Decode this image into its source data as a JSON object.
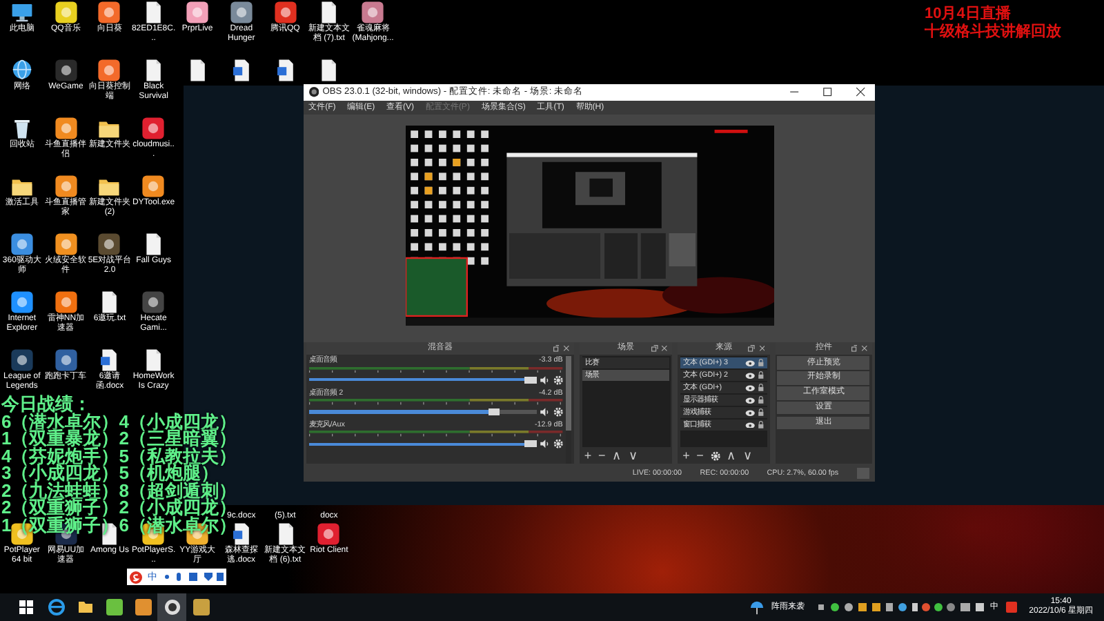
{
  "desktop": {
    "icon_rows": [
      [
        {
          "kind": "computer",
          "label": "此电脑"
        },
        {
          "kind": "app",
          "color": "#e8d020",
          "label": "QQ音乐"
        },
        {
          "kind": "app",
          "color": "#f36a2a",
          "label": "向日葵"
        },
        {
          "kind": "file",
          "label": "82ED1E8C..."
        },
        {
          "kind": "app",
          "color": "#f2a0b8",
          "label": "PrprLive"
        },
        {
          "kind": "app",
          "color": "#7a8a9a",
          "label": "Dread Hunger"
        },
        {
          "kind": "app",
          "color": "#e03020",
          "label": "腾讯QQ"
        },
        {
          "kind": "file",
          "label": "新建文本文档 (7).txt"
        },
        {
          "kind": "app",
          "color": "#c87a90",
          "label": "雀魂麻将 (Mahjong..."
        }
      ],
      [
        {
          "kind": "network",
          "label": "网络"
        },
        {
          "kind": "app",
          "color": "#2a2a2a",
          "label": "WeGame"
        },
        {
          "kind": "app",
          "color": "#f36a2a",
          "label": "向日葵控制端"
        },
        {
          "kind": "file",
          "label": "Black Survival"
        },
        {
          "kind": "file"
        },
        {
          "kind": "doc"
        },
        {
          "kind": "doc"
        },
        {
          "kind": "file"
        }
      ],
      [
        {
          "kind": "recycle",
          "label": "回收站"
        },
        {
          "kind": "app",
          "color": "#f08a20",
          "label": "斗鱼直播伴侣"
        },
        {
          "kind": "folder",
          "label": "新建文件夹"
        },
        {
          "kind": "app",
          "color": "#e02030",
          "label": "cloudmusi..."
        }
      ],
      [
        {
          "kind": "folder",
          "label": "激活工具"
        },
        {
          "kind": "app",
          "color": "#f08a20",
          "label": "斗鱼直播管家"
        },
        {
          "kind": "folder",
          "label": "新建文件夹 (2)"
        },
        {
          "kind": "app",
          "color": "#f08a20",
          "label": "DYTool.exe"
        }
      ],
      [
        {
          "kind": "app",
          "color": "#3b8ee0",
          "label": "360驱动大师"
        },
        {
          "kind": "app",
          "color": "#f09020",
          "label": "火绒安全软件"
        },
        {
          "kind": "app",
          "color": "#5a4a30",
          "label": "5E对战平台 2.0"
        },
        {
          "kind": "file",
          "label": "Fall Guys"
        }
      ],
      [
        {
          "kind": "app",
          "color": "#1e90ff",
          "label": "Internet Explorer"
        },
        {
          "kind": "app",
          "color": "#f07010",
          "label": "雷神NN加速器"
        },
        {
          "kind": "file",
          "label": "6邀玩.txt"
        },
        {
          "kind": "app",
          "color": "#444444",
          "label": "Hecate Gami..."
        }
      ],
      [
        {
          "kind": "app",
          "color": "#1a3a5a",
          "label": "League of Legends"
        },
        {
          "kind": "app",
          "color": "#3060a0",
          "label": "跑跑卡丁车"
        },
        {
          "kind": "doc",
          "label": "6邀请函.docx"
        },
        {
          "kind": "file",
          "label": "HomeWork Is Crazy"
        }
      ],
      [
        {
          "kind": "gap"
        }
      ],
      [
        {
          "kind": "gap"
        },
        {
          "kind": "gap"
        },
        {
          "kind": "gap"
        },
        {
          "kind": "gap"
        },
        {
          "kind": "gap"
        },
        {
          "kind": "fragment",
          "label": "9c.docx"
        },
        {
          "kind": "fragment",
          "label": "(5).txt"
        },
        {
          "kind": "fragment",
          "label": "docx"
        }
      ],
      [
        {
          "kind": "app",
          "color": "#f0c020",
          "label": "PotPlayer 64 bit"
        },
        {
          "kind": "app",
          "color": "#1a2a4a",
          "label": "网易UU加速器"
        },
        {
          "kind": "file",
          "label": "Among Us"
        },
        {
          "kind": "app",
          "color": "#f0c020",
          "label": "PotPlayerS..."
        },
        {
          "kind": "app",
          "color": "#f0b030",
          "label": "YY游戏大厅"
        },
        {
          "kind": "doc",
          "label": "森林查探逃.docx"
        },
        {
          "kind": "file",
          "label": "新建文本文档 (6).txt"
        },
        {
          "kind": "app",
          "color": "#e02030",
          "label": "Riot Client"
        }
      ]
    ]
  },
  "stats_overlay": {
    "title": "今日战绩：",
    "lines": [
      "6（潜水卓尔）4（小成四龙）",
      "1（双重暴龙）2（三星暗翼）",
      "4（芬妮炮手）5（私教拉夫）",
      "3（小成四龙）5（机炮腿）",
      "2（九法蛙蛙）8（超剑遁刺）",
      "2（双重狮子）2（小成四龙）",
      "1（双重狮子）6（潜水卓尔）"
    ]
  },
  "stream_notice": [
    "10月4日直播",
    "十级格斗技讲解回放"
  ],
  "obs_window": {
    "title": "OBS 23.0.1 (32-bit, windows) - 配置文件: 未命名 - 场景: 未命名",
    "menu": [
      {
        "label": "文件(F)",
        "disabled": false
      },
      {
        "label": "编辑(E)",
        "disabled": false
      },
      {
        "label": "查看(V)",
        "disabled": false
      },
      {
        "label": "配置文件(P)",
        "disabled": true
      },
      {
        "label": "场景集合(S)",
        "disabled": false
      },
      {
        "label": "工具(T)",
        "disabled": false
      },
      {
        "label": "帮助(H)",
        "disabled": false
      }
    ],
    "mixer": {
      "title": "混音器",
      "channels": [
        {
          "name": "桌面音频",
          "reading": "-3.3 dB",
          "level": 1.0
        },
        {
          "name": "桌面音频 2",
          "reading": "-4.2 dB",
          "level": 0.84
        },
        {
          "name": "麦克风/Aux",
          "reading": "-12.9 dB",
          "level": 1.0
        }
      ]
    },
    "scenes": {
      "title": "场景",
      "items": [
        {
          "label": "比赛",
          "selected": false
        },
        {
          "label": "场景",
          "selected": true
        }
      ],
      "toolbar": [
        {
          "kind": "glyph",
          "text": "+"
        },
        {
          "kind": "glyph",
          "text": "−"
        },
        {
          "kind": "glyph",
          "text": "∧"
        },
        {
          "kind": "glyph",
          "text": "∨"
        }
      ]
    },
    "sources": {
      "title": "来源",
      "items": [
        {
          "label": "文本 (GDI+) 3",
          "selected": true
        },
        {
          "label": "文本 (GDI+) 2",
          "selected": false
        },
        {
          "label": "文本 (GDI+)",
          "selected": false
        },
        {
          "label": "显示器捕获",
          "selected": false
        },
        {
          "label": "游戏捕获",
          "selected": false
        },
        {
          "label": "窗口捕获",
          "selected": false
        }
      ],
      "toolbar": [
        {
          "kind": "glyph",
          "text": "+"
        },
        {
          "kind": "glyph",
          "text": "−"
        },
        {
          "kind": "gear"
        },
        {
          "kind": "glyph",
          "text": "∧"
        },
        {
          "kind": "glyph",
          "text": "∨"
        }
      ]
    },
    "controls": {
      "title": "控件",
      "buttons": [
        "停止预览",
        "开始录制",
        "工作室模式",
        "设置",
        "退出"
      ]
    },
    "status": [
      "LIVE: 00:00:00",
      "REC: 00:00:00",
      "CPU: 2.7%, 60.00 fps"
    ]
  },
  "ime_bar": {
    "mode": "中"
  },
  "taskbar": {
    "apps": [
      {
        "kind": "browser",
        "active": false
      },
      {
        "kind": "folder",
        "active": false
      },
      {
        "kind": "app",
        "color": "#6ac040",
        "active": false
      },
      {
        "kind": "app",
        "color": "#e09030",
        "active": false
      },
      {
        "kind": "obs",
        "active": true
      },
      {
        "kind": "app",
        "color": "#c8a040",
        "active": false
      }
    ],
    "weather": "阵雨来袭",
    "ime": "中",
    "time": "15:40",
    "date": "2022/10/6 星期四"
  }
}
